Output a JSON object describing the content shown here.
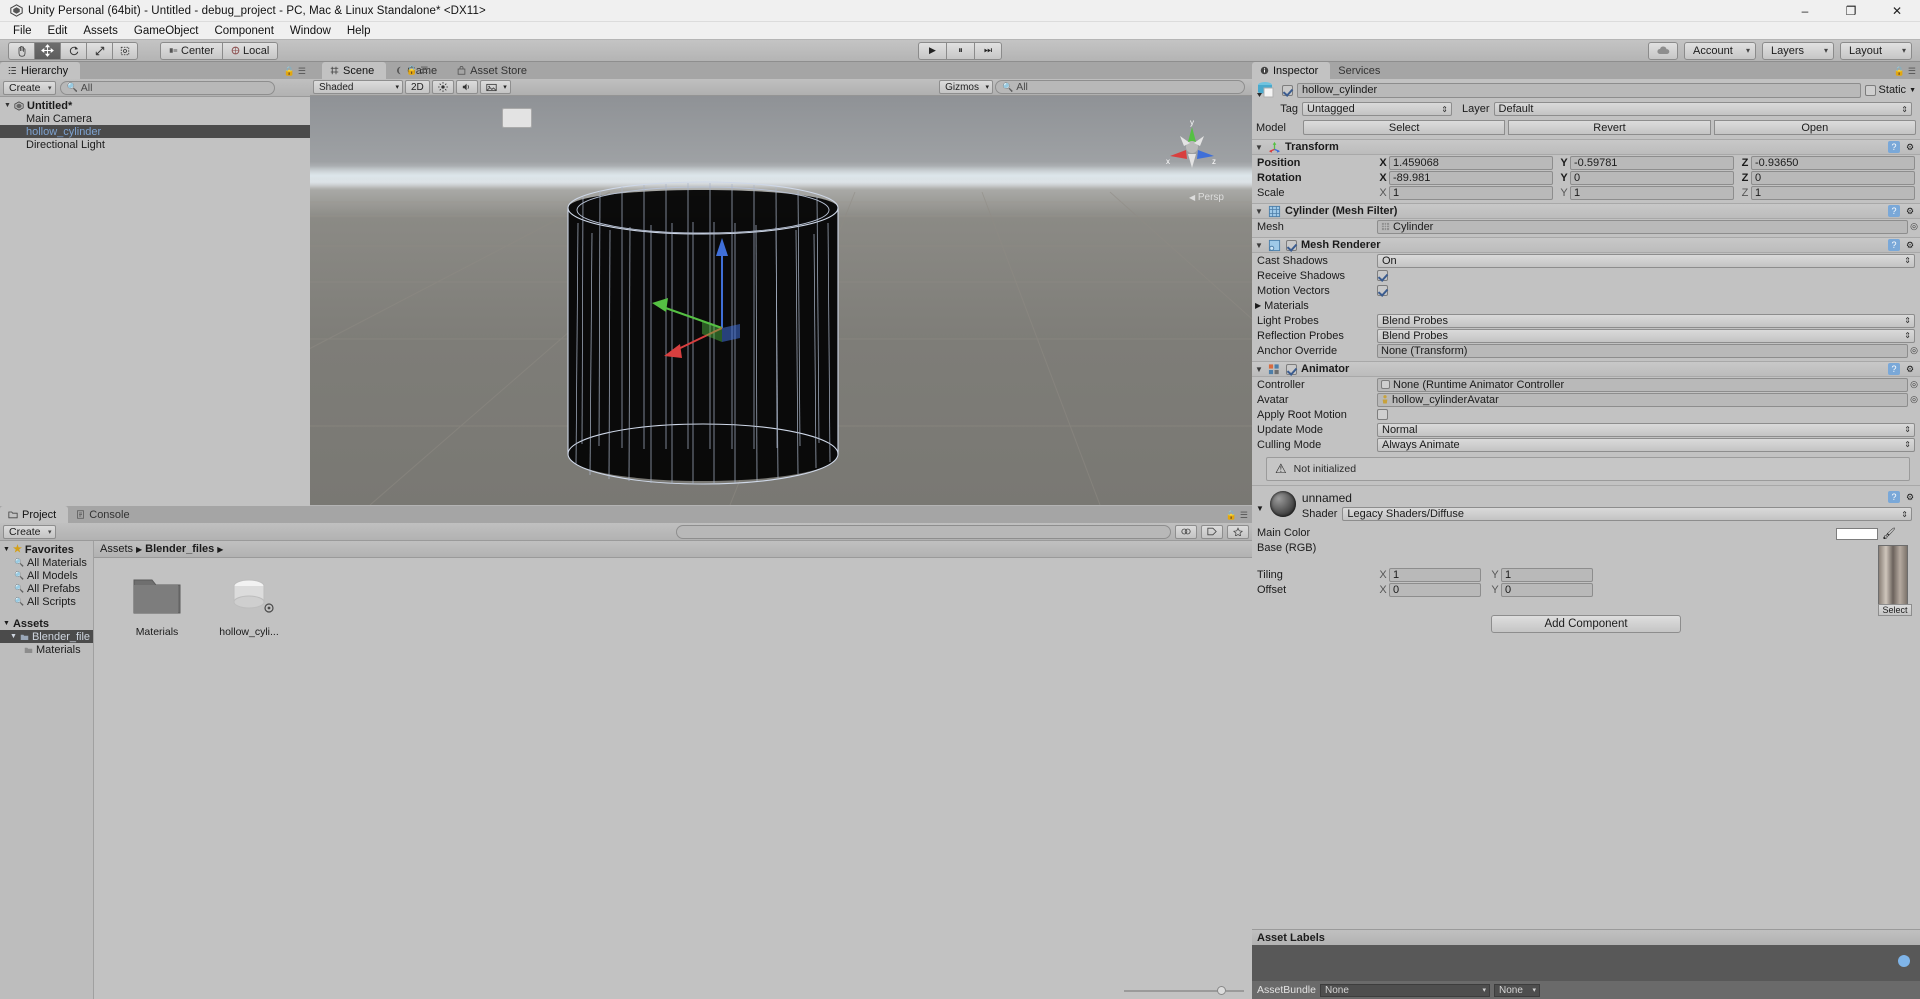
{
  "window": {
    "title": "Unity Personal (64bit) - Untitled - debug_project - PC, Mac & Linux Standalone* <DX11>",
    "minimize": "–",
    "maximize": "❐",
    "close": "✕"
  },
  "menu": [
    "File",
    "Edit",
    "Assets",
    "GameObject",
    "Component",
    "Window",
    "Help"
  ],
  "toolbar": {
    "tools": [
      {
        "name": "hand-tool",
        "glyph": "✋"
      },
      {
        "name": "move-tool",
        "glyph": "✥"
      },
      {
        "name": "rotate-tool",
        "glyph": "↻"
      },
      {
        "name": "scale-tool",
        "glyph": "⤡"
      },
      {
        "name": "rect-tool",
        "glyph": "⧉"
      }
    ],
    "pivot": "Center",
    "handle": "Local",
    "play": "▶",
    "pause": "⏸",
    "step": "⏭",
    "account": "Account",
    "layers": "Layers",
    "layout": "Layout"
  },
  "hierarchy": {
    "tab": "Hierarchy",
    "create": "Create",
    "search_placeholder": "All",
    "items": [
      {
        "label": "Untitled*",
        "depth": 0,
        "selected": false,
        "scene": true
      },
      {
        "label": "Main Camera",
        "depth": 1,
        "selected": false,
        "scene": false
      },
      {
        "label": "hollow_cylinder",
        "depth": 1,
        "selected": true,
        "scene": false
      },
      {
        "label": "Directional Light",
        "depth": 1,
        "selected": false,
        "scene": false
      }
    ]
  },
  "scene": {
    "tabs": [
      {
        "label": "Scene",
        "active": true
      },
      {
        "label": "Game",
        "active": false
      },
      {
        "label": "Asset Store",
        "active": false
      }
    ],
    "shading": "Shaded",
    "mode2d": "2D",
    "gizmos": "Gizmos",
    "search_placeholder": "All",
    "perspective_label": "Persp",
    "axis_labels": {
      "x": "x",
      "y": "y",
      "z": "z"
    }
  },
  "project": {
    "tabs": [
      {
        "label": "Project",
        "active": true
      },
      {
        "label": "Console",
        "active": false
      }
    ],
    "create": "Create",
    "breadcrumb": [
      "Assets",
      "Blender_files"
    ],
    "favorites_header": "Favorites",
    "favorites": [
      "All Materials",
      "All Models",
      "All Prefabs",
      "All Scripts"
    ],
    "assets_header": "Assets",
    "tree": [
      {
        "label": "Blender_file",
        "depth": 1,
        "selected": true
      },
      {
        "label": "Materials",
        "depth": 2,
        "selected": false
      }
    ],
    "grid": [
      {
        "label": "Materials",
        "type": "folder"
      },
      {
        "label": "hollow_cyli...",
        "type": "model"
      }
    ]
  },
  "inspector": {
    "tabs": [
      {
        "label": "Inspector",
        "active": true
      },
      {
        "label": "Services",
        "active": false
      }
    ],
    "object_name": "hollow_cylinder",
    "object_enabled": true,
    "static_label": "Static",
    "static_checked": false,
    "tag_label": "Tag",
    "tag_value": "Untagged",
    "layer_label": "Layer",
    "layer_value": "Default",
    "model_label": "Model",
    "model_buttons": [
      "Select",
      "Revert",
      "Open"
    ],
    "transform": {
      "title": "Transform",
      "position_label": "Position",
      "position": {
        "x": "1.459068",
        "y": "-0.59781",
        "z": "-0.93650"
      },
      "rotation_label": "Rotation",
      "rotation": {
        "x": "-89.981",
        "y": "0",
        "z": "0"
      },
      "scale_label": "Scale",
      "scale": {
        "x": "1",
        "y": "1",
        "z": "1"
      }
    },
    "mesh_filter": {
      "title": "Cylinder (Mesh Filter)",
      "mesh_label": "Mesh",
      "mesh_value": "Cylinder"
    },
    "mesh_renderer": {
      "title": "Mesh Renderer",
      "enabled": true,
      "cast_shadows_label": "Cast Shadows",
      "cast_shadows_value": "On",
      "receive_shadows_label": "Receive Shadows",
      "receive_shadows_checked": true,
      "motion_vectors_label": "Motion Vectors",
      "motion_vectors_checked": true,
      "materials_label": "Materials",
      "light_probes_label": "Light Probes",
      "light_probes_value": "Blend Probes",
      "reflection_probes_label": "Reflection Probes",
      "reflection_probes_value": "Blend Probes",
      "anchor_override_label": "Anchor Override",
      "anchor_override_value": "None (Transform)"
    },
    "animator": {
      "title": "Animator",
      "enabled": true,
      "controller_label": "Controller",
      "controller_value": "None (Runtime Animator Controller",
      "avatar_label": "Avatar",
      "avatar_value": "hollow_cylinderAvatar",
      "apply_root_motion_label": "Apply Root Motion",
      "apply_root_motion_checked": false,
      "update_mode_label": "Update Mode",
      "update_mode_value": "Normal",
      "culling_mode_label": "Culling Mode",
      "culling_mode_value": "Always Animate",
      "warning": "Not initialized"
    },
    "material": {
      "name": "unnamed",
      "shader_label": "Shader",
      "shader_value": "Legacy Shaders/Diffuse",
      "main_color_label": "Main Color",
      "main_color_value": "#FFFFFF",
      "base_rgb_label": "Base (RGB)",
      "tiling_label": "Tiling",
      "tiling": {
        "x": "1",
        "y": "1"
      },
      "offset_label": "Offset",
      "offset": {
        "x": "0",
        "y": "0"
      },
      "select_button": "Select"
    },
    "add_component": "Add Component",
    "asset_labels_title": "Asset Labels",
    "assetbundle_label": "AssetBundle",
    "assetbundle_value": "None",
    "assetbundle_variant": "None"
  },
  "colors": {
    "chrome": "#c2c2c2",
    "selection": "#4b4b4b",
    "selected_text": "#7da2d0",
    "axis_x": "#d83f3f",
    "axis_y": "#55c043",
    "axis_z": "#3f6fd8"
  }
}
